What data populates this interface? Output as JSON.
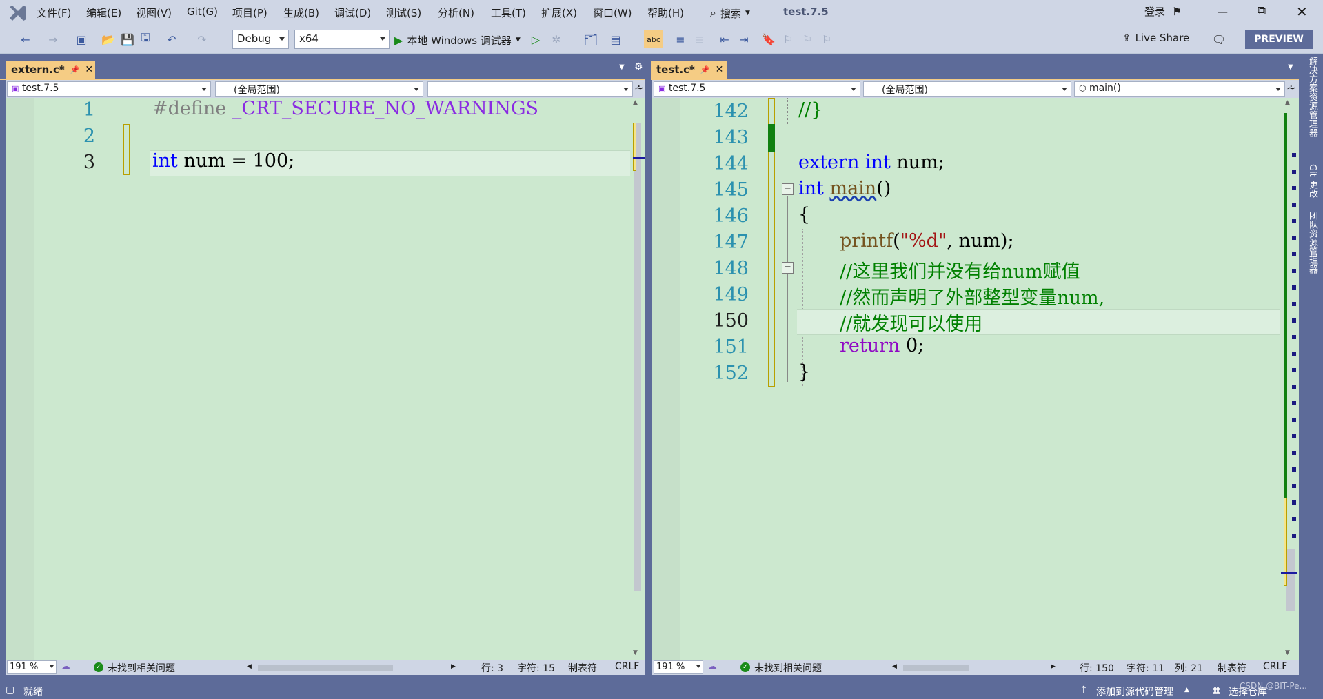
{
  "menubar": {
    "items": [
      "文件(F)",
      "编辑(E)",
      "视图(V)",
      "Git(G)",
      "项目(P)",
      "生成(B)",
      "调试(D)",
      "测试(S)",
      "分析(N)",
      "工具(T)",
      "扩展(X)",
      "窗口(W)",
      "帮助(H)"
    ],
    "search_label": "搜索",
    "solution_title": "test.7.5",
    "login_label": "登录",
    "window_controls": [
      "minimize",
      "restore",
      "close"
    ]
  },
  "toolbar": {
    "config": "Debug",
    "platform": "x64",
    "run_label": "本地 Windows 调试器",
    "live_share": "Live Share",
    "preview": "PREVIEW"
  },
  "left_pane": {
    "tab_title": "extern.c*",
    "nav_project": "test.7.5",
    "nav_scope": "(全局范围)",
    "nav_member": "",
    "lines": [
      {
        "num": "1",
        "text": "#define _CRT_SECURE_NO_WARNINGS"
      },
      {
        "num": "2",
        "text": ""
      },
      {
        "num": "3",
        "text": "int num = 100;"
      }
    ],
    "status": {
      "zoom": "191 %",
      "issues": "未找到相关问题",
      "row": "行: 3",
      "char": "字符: 15",
      "tab": "制表符",
      "eol": "CRLF"
    }
  },
  "right_pane": {
    "tab_title": "test.c*",
    "nav_project": "test.7.5",
    "nav_scope": "(全局范围)",
    "nav_member": "main()",
    "lines": [
      {
        "num": "142",
        "text": "//}"
      },
      {
        "num": "143",
        "text": ""
      },
      {
        "num": "144",
        "text": "extern int num;"
      },
      {
        "num": "145",
        "text": "int main()"
      },
      {
        "num": "146",
        "text": "{"
      },
      {
        "num": "147",
        "text": "printf(\"%d\", num);"
      },
      {
        "num": "148",
        "text": "//这里我们并没有给num赋值"
      },
      {
        "num": "149",
        "text": "//然而声明了外部整型变量num,"
      },
      {
        "num": "150",
        "text": "//就发现可以使用"
      },
      {
        "num": "151",
        "text": "return 0;"
      },
      {
        "num": "152",
        "text": "}"
      }
    ],
    "status": {
      "zoom": "191 %",
      "issues": "未找到相关问题",
      "row": "行: 150",
      "char": "字符: 11",
      "col": "列: 21",
      "tab": "制表符",
      "eol": "CRLF"
    }
  },
  "main_status": {
    "ready": "就绪",
    "source_control": "添加到源代码管理",
    "select_repo": "选择仓库",
    "watermark": "CSDN @BIT-Pe..."
  },
  "dock": {
    "items": [
      "解决方案资源管理器",
      "Git 更改",
      "团队资源管理器"
    ]
  },
  "colors": {
    "editor_bg": "#cce8cf",
    "chrome": "#cfd6e5",
    "frame": "#5d6b99",
    "active_tab": "#f5cc84",
    "keyword": "#0000ff",
    "comment": "#008000",
    "macro": "#8a2be2"
  }
}
